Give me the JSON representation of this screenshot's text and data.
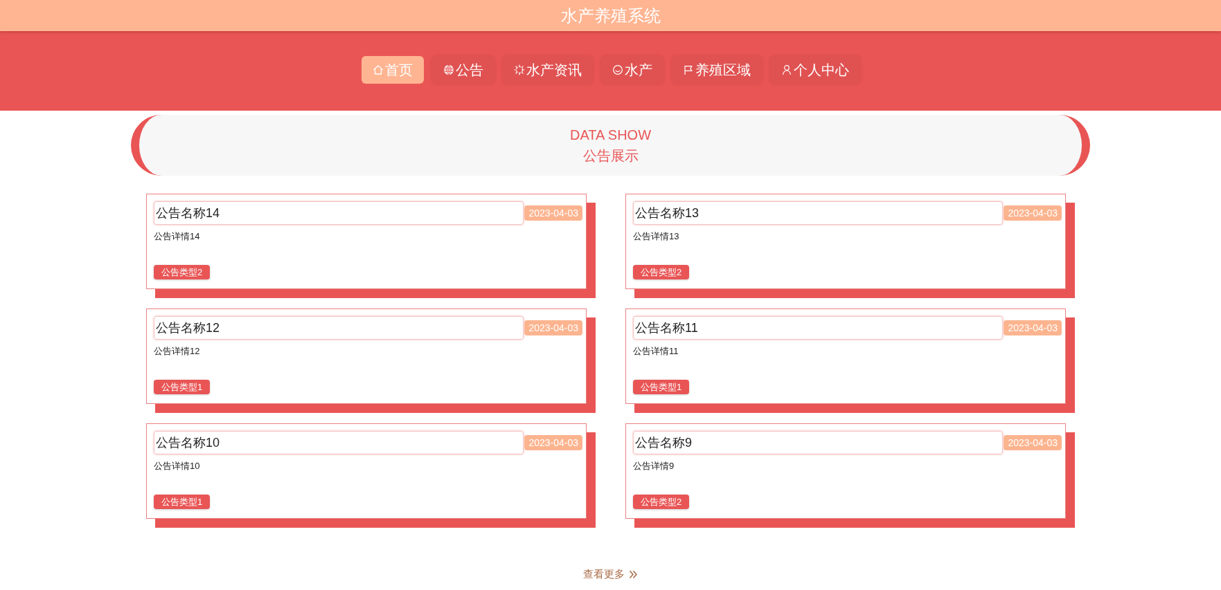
{
  "header": {
    "title": "水产养殖系统"
  },
  "nav": [
    {
      "label": "首页",
      "selected": true
    },
    {
      "label": "公告",
      "selected": false
    },
    {
      "label": "水产资讯",
      "selected": false
    },
    {
      "label": "水产",
      "selected": false
    },
    {
      "label": "养殖区域",
      "selected": false
    },
    {
      "label": "个人中心",
      "selected": false
    }
  ],
  "section": {
    "subtitle": "DATA SHOW",
    "title": "公告展示"
  },
  "notices": [
    {
      "title": "公告名称14",
      "date": "2023-04-03",
      "detail": "公告详情14",
      "type": "公告类型2"
    },
    {
      "title": "公告名称13",
      "date": "2023-04-03",
      "detail": "公告详情13",
      "type": "公告类型2"
    },
    {
      "title": "公告名称12",
      "date": "2023-04-03",
      "detail": "公告详情12",
      "type": "公告类型1"
    },
    {
      "title": "公告名称11",
      "date": "2023-04-03",
      "detail": "公告详情11",
      "type": "公告类型1"
    },
    {
      "title": "公告名称10",
      "date": "2023-04-03",
      "detail": "公告详情10",
      "type": "公告类型1"
    },
    {
      "title": "公告名称9",
      "date": "2023-04-03",
      "detail": "公告详情9",
      "type": "公告类型2"
    }
  ],
  "more_link": {
    "label": "查看更多"
  }
}
